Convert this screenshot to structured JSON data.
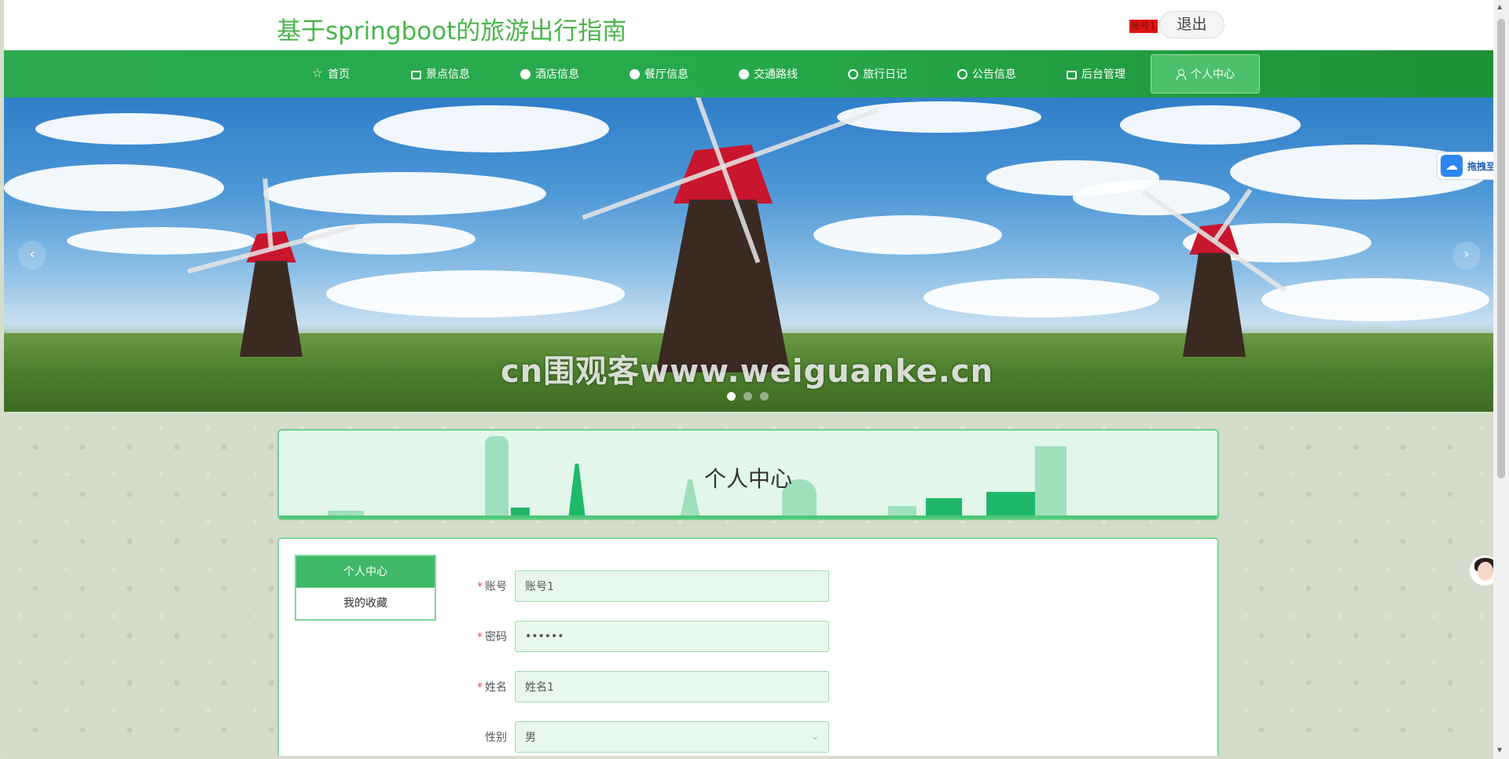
{
  "header": {
    "site_title": "基于springboot的旅游出行指南",
    "user_badge": "账号1",
    "logout_label": "退出"
  },
  "nav": {
    "items": [
      {
        "label": "首页",
        "icon": "star-icon"
      },
      {
        "label": "景点信息",
        "icon": "bag-icon"
      },
      {
        "label": "酒店信息",
        "icon": "info-icon"
      },
      {
        "label": "餐厅信息",
        "icon": "help-icon"
      },
      {
        "label": "交通路线",
        "icon": "info-icon"
      },
      {
        "label": "旅行日记",
        "icon": "circle-icon"
      },
      {
        "label": "公告信息",
        "icon": "smile-icon"
      },
      {
        "label": "后台管理",
        "icon": "bag-icon"
      },
      {
        "label": "个人中心",
        "icon": "user-icon",
        "active": true
      }
    ]
  },
  "banner": {
    "watermark": "cn围观客www.weiguanke.cn",
    "prev_arrow": "‹",
    "next_arrow": "›",
    "dot_count": 3,
    "active_dot": 0
  },
  "page": {
    "heading": "个人中心"
  },
  "side_menu": {
    "items": [
      "个人中心",
      "我的收藏"
    ],
    "active": 0
  },
  "form": {
    "fields": [
      {
        "label": "账号",
        "value": "账号1",
        "required": true
      },
      {
        "label": "密码",
        "value": "••••••",
        "required": true
      },
      {
        "label": "姓名",
        "value": "姓名1",
        "required": true
      },
      {
        "label": "性别",
        "value": "男",
        "required": false,
        "type": "select"
      }
    ],
    "required_mark": "*",
    "select_chevron": "⌄"
  },
  "widgets": {
    "baidu_label": "拖拽至此",
    "baidu_icon": "baidu-netdisk-icon"
  },
  "colors": {
    "brand_green": "#4ab54a",
    "nav_green": "#27a94b",
    "active_green": "#3fb968",
    "panel_border": "#7fd59a"
  }
}
